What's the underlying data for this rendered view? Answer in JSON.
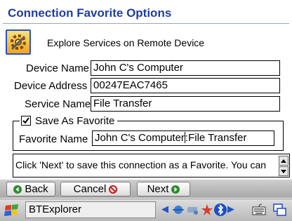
{
  "dialog": {
    "title": "Connection Favorite Options",
    "subtitle": "Explore Services on Remote Device"
  },
  "form": {
    "device_name": {
      "label": "Device Name :",
      "value": "John C's Computer"
    },
    "device_address": {
      "label": "Device Address :",
      "value": "00247EAC7465"
    },
    "service_name": {
      "label": "Service Name :",
      "value": "File Transfer"
    },
    "save_as_favorite": {
      "label": "Save As Favorite",
      "checked": true
    },
    "favorite_name": {
      "label": "Favorite Name :",
      "value_before_caret": "John C's Computer",
      "value_after_caret": ":File Transfer"
    }
  },
  "message": "Click 'Next' to save this connection as a Favorite.  You can",
  "buttons": {
    "back": "Back",
    "cancel": "Cancel",
    "next": "Next"
  },
  "taskbar": {
    "app_name": "BTExplorer"
  },
  "colors": {
    "title": "#1f3f9f",
    "back_icon": "#2e8b2e",
    "cancel_icon": "#d01818",
    "next_icon": "#2e8b2e"
  },
  "icons": {
    "app": "gear-wrench-icon",
    "back": "back-arrow-icon",
    "cancel": "cancel-icon",
    "next": "next-arrow-icon",
    "start": "windows-flag-icon",
    "keyboard": "keyboard-icon",
    "windows": "windows-switcher-icon"
  }
}
